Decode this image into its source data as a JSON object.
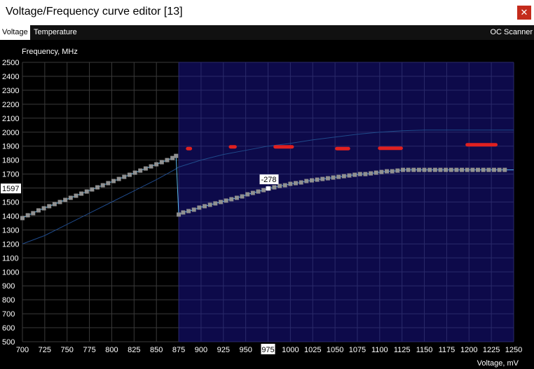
{
  "window": {
    "title": "Voltage/Frequency curve editor [13]",
    "close_glyph": "✕"
  },
  "tabs": [
    {
      "label": "Voltage",
      "active": true
    },
    {
      "label": "Temperature",
      "active": false
    }
  ],
  "oc_scanner_label": "OC Scanner",
  "chart_data": {
    "type": "line",
    "ylabel": "Frequency, MHz",
    "xlabel": "Voltage, mV",
    "xlim": [
      700,
      1250
    ],
    "ylim": [
      500,
      2500
    ],
    "x_ticks": [
      700,
      725,
      750,
      775,
      800,
      825,
      850,
      875,
      900,
      925,
      950,
      975,
      1000,
      1025,
      1050,
      1075,
      1100,
      1125,
      1150,
      1175,
      1200,
      1225,
      1250
    ],
    "y_ticks": [
      500,
      600,
      700,
      800,
      900,
      1000,
      1100,
      1200,
      1300,
      1400,
      1500,
      1600,
      1700,
      1800,
      1900,
      2000,
      2100,
      2200,
      2300,
      2400,
      2500
    ],
    "grid": true,
    "highlighted_region_start": 875,
    "cursor": {
      "voltage": 975,
      "frequency": 1597,
      "offset_label": "-278",
      "voltage_label": "975",
      "frequency_label": "1597"
    },
    "curve_points": [
      [
        700,
        1385
      ],
      [
        706,
        1405
      ],
      [
        712,
        1420
      ],
      [
        718,
        1440
      ],
      [
        724,
        1455
      ],
      [
        730,
        1470
      ],
      [
        736,
        1485
      ],
      [
        742,
        1500
      ],
      [
        748,
        1515
      ],
      [
        754,
        1530
      ],
      [
        760,
        1545
      ],
      [
        766,
        1560
      ],
      [
        772,
        1575
      ],
      [
        778,
        1590
      ],
      [
        784,
        1605
      ],
      [
        790,
        1620
      ],
      [
        796,
        1635
      ],
      [
        802,
        1650
      ],
      [
        808,
        1665
      ],
      [
        814,
        1680
      ],
      [
        820,
        1695
      ],
      [
        826,
        1710
      ],
      [
        832,
        1725
      ],
      [
        838,
        1740
      ],
      [
        844,
        1755
      ],
      [
        850,
        1770
      ],
      [
        856,
        1785
      ],
      [
        862,
        1800
      ],
      [
        868,
        1815
      ],
      [
        872,
        1830
      ],
      [
        875,
        1410
      ],
      [
        880,
        1425
      ],
      [
        886,
        1435
      ],
      [
        892,
        1445
      ],
      [
        898,
        1460
      ],
      [
        904,
        1470
      ],
      [
        910,
        1480
      ],
      [
        916,
        1490
      ],
      [
        922,
        1500
      ],
      [
        928,
        1510
      ],
      [
        934,
        1520
      ],
      [
        940,
        1530
      ],
      [
        946,
        1540
      ],
      [
        952,
        1555
      ],
      [
        958,
        1565
      ],
      [
        964,
        1575
      ],
      [
        970,
        1585
      ],
      [
        976,
        1597
      ],
      [
        982,
        1605
      ],
      [
        988,
        1615
      ],
      [
        994,
        1620
      ],
      [
        1000,
        1630
      ],
      [
        1006,
        1635
      ],
      [
        1012,
        1640
      ],
      [
        1018,
        1650
      ],
      [
        1024,
        1655
      ],
      [
        1030,
        1660
      ],
      [
        1036,
        1665
      ],
      [
        1042,
        1670
      ],
      [
        1048,
        1675
      ],
      [
        1054,
        1680
      ],
      [
        1060,
        1685
      ],
      [
        1066,
        1690
      ],
      [
        1072,
        1695
      ],
      [
        1078,
        1700
      ],
      [
        1084,
        1700
      ],
      [
        1090,
        1705
      ],
      [
        1096,
        1710
      ],
      [
        1102,
        1715
      ],
      [
        1108,
        1720
      ],
      [
        1114,
        1720
      ],
      [
        1120,
        1725
      ],
      [
        1126,
        1730
      ],
      [
        1132,
        1730
      ],
      [
        1138,
        1730
      ],
      [
        1144,
        1730
      ],
      [
        1150,
        1730
      ],
      [
        1156,
        1730
      ],
      [
        1162,
        1730
      ],
      [
        1168,
        1730
      ],
      [
        1174,
        1730
      ],
      [
        1180,
        1730
      ],
      [
        1186,
        1730
      ],
      [
        1192,
        1730
      ],
      [
        1198,
        1730
      ],
      [
        1204,
        1730
      ],
      [
        1210,
        1730
      ],
      [
        1216,
        1730
      ],
      [
        1222,
        1730
      ],
      [
        1228,
        1730
      ],
      [
        1234,
        1730
      ],
      [
        1240,
        1730
      ]
    ],
    "original_curve": [
      [
        700,
        1200
      ],
      [
        725,
        1260
      ],
      [
        750,
        1340
      ],
      [
        775,
        1420
      ],
      [
        800,
        1500
      ],
      [
        825,
        1580
      ],
      [
        850,
        1660
      ],
      [
        870,
        1730
      ],
      [
        875,
        1750
      ],
      [
        900,
        1800
      ],
      [
        925,
        1840
      ],
      [
        950,
        1870
      ],
      [
        975,
        1900
      ],
      [
        1000,
        1920
      ],
      [
        1025,
        1945
      ],
      [
        1050,
        1965
      ],
      [
        1075,
        1985
      ],
      [
        1100,
        2000
      ],
      [
        1125,
        2010
      ],
      [
        1150,
        2015
      ],
      [
        1175,
        2015
      ],
      [
        1200,
        2015
      ],
      [
        1225,
        2015
      ],
      [
        1250,
        2015
      ]
    ],
    "marker_segments": [
      [
        885,
        888,
        1882
      ],
      [
        933,
        938,
        1895
      ],
      [
        983,
        1002,
        1895
      ],
      [
        1052,
        1065,
        1882
      ],
      [
        1100,
        1124,
        1885
      ],
      [
        1198,
        1230,
        1910
      ]
    ],
    "colors": {
      "plot_bg": "#000000",
      "region_bg": "#0d0a4a",
      "grid": "#3a3a3a",
      "region_grid": "#2a2a6a",
      "curve": "#5bb8f0",
      "curve_marker": "#909090",
      "original": "#1f4a8a",
      "marker_red": "#e02020",
      "axis_text": "#ffffff"
    }
  }
}
